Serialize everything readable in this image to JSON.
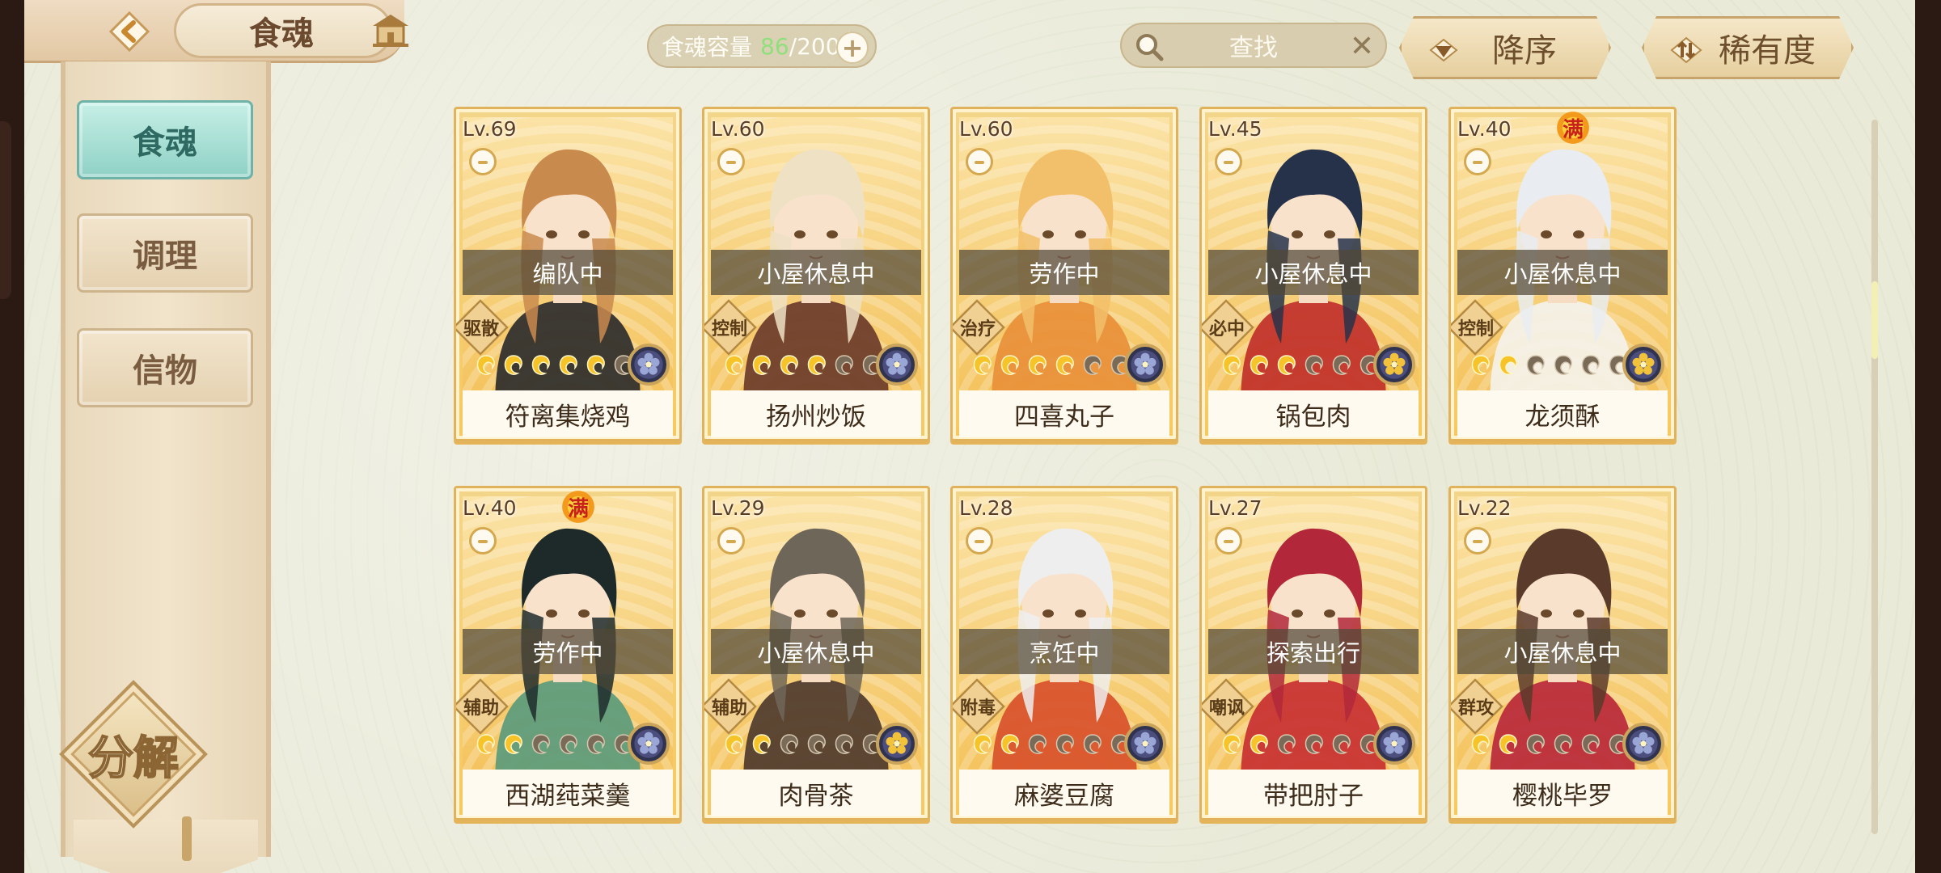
{
  "header": {
    "title": "食魂",
    "capacity_label": "食魂容量",
    "capacity_current": "86",
    "capacity_max": "/200",
    "add_symbol": "+",
    "search_placeholder": "查找",
    "sort_order_label": "降序",
    "sort_by_label": "稀有度"
  },
  "sidebar": {
    "tabs": [
      {
        "label": "食魂",
        "active": true
      },
      {
        "label": "调理",
        "active": false
      },
      {
        "label": "信物",
        "active": false
      }
    ],
    "decompose_label": "分解"
  },
  "cards": [
    {
      "level": "Lv.69",
      "status": "编队中",
      "role": "驱散",
      "name": "符离集烧鸡",
      "stars": 5,
      "maxed": false,
      "hair": "#c98a4e",
      "outfit": "#2c2c2c",
      "rarity_icon": "flower-blue"
    },
    {
      "level": "Lv.60",
      "status": "小屋休息中",
      "role": "控制",
      "name": "扬州炒饭",
      "stars": 4,
      "maxed": false,
      "hair": "#eee1c4",
      "outfit": "#6b3b2a",
      "rarity_icon": "flower-blue"
    },
    {
      "level": "Lv.60",
      "status": "劳作中",
      "role": "治疗",
      "name": "四喜丸子",
      "stars": 4,
      "maxed": false,
      "hair": "#f2c06a",
      "outfit": "#e8903a",
      "rarity_icon": "flower-blue"
    },
    {
      "level": "Lv.45",
      "status": "小屋休息中",
      "role": "必中",
      "name": "锅包肉",
      "stars": 3,
      "maxed": false,
      "hair": "#26324a",
      "outfit": "#c0302a",
      "rarity_icon": "flower-gold"
    },
    {
      "level": "Lv.40",
      "status": "小屋休息中",
      "role": "控制",
      "name": "龙须酥",
      "stars": 2,
      "maxed": true,
      "hair": "#e9ecf0",
      "outfit": "#f4f2ea",
      "rarity_icon": "flower-gold"
    },
    {
      "level": "Lv.40",
      "status": "劳作中",
      "role": "辅助",
      "name": "西湖莼菜羹",
      "stars": 2,
      "maxed": true,
      "hair": "#1e2a2a",
      "outfit": "#5b9b7c",
      "rarity_icon": "flower-blue"
    },
    {
      "level": "Lv.29",
      "status": "小屋休息中",
      "role": "辅助",
      "name": "肉骨茶",
      "stars": 2,
      "maxed": false,
      "hair": "#6e6658",
      "outfit": "#4e3a2c",
      "rarity_icon": "flower-gold"
    },
    {
      "level": "Lv.28",
      "status": "烹饪中",
      "role": "附毒",
      "name": "麻婆豆腐",
      "stars": 2,
      "maxed": false,
      "hair": "#eeeeee",
      "outfit": "#d8502a",
      "rarity_icon": "flower-blue"
    },
    {
      "level": "Lv.27",
      "status": "探索出行",
      "role": "嘲讽",
      "name": "带把肘子",
      "stars": 2,
      "maxed": false,
      "hair": "#b2283a",
      "outfit": "#c83032",
      "rarity_icon": "flower-blue"
    },
    {
      "level": "Lv.22",
      "status": "小屋休息中",
      "role": "群攻",
      "name": "樱桃毕罗",
      "stars": 2,
      "maxed": false,
      "hair": "#5a3a2a",
      "outfit": "#b8283a",
      "rarity_icon": "flower-blue"
    }
  ],
  "man_label": "满",
  "colors": {
    "accent_teal": "#8fd1c5",
    "capacity_green": "#8fe07c",
    "card_gold": "#f4c25b"
  }
}
